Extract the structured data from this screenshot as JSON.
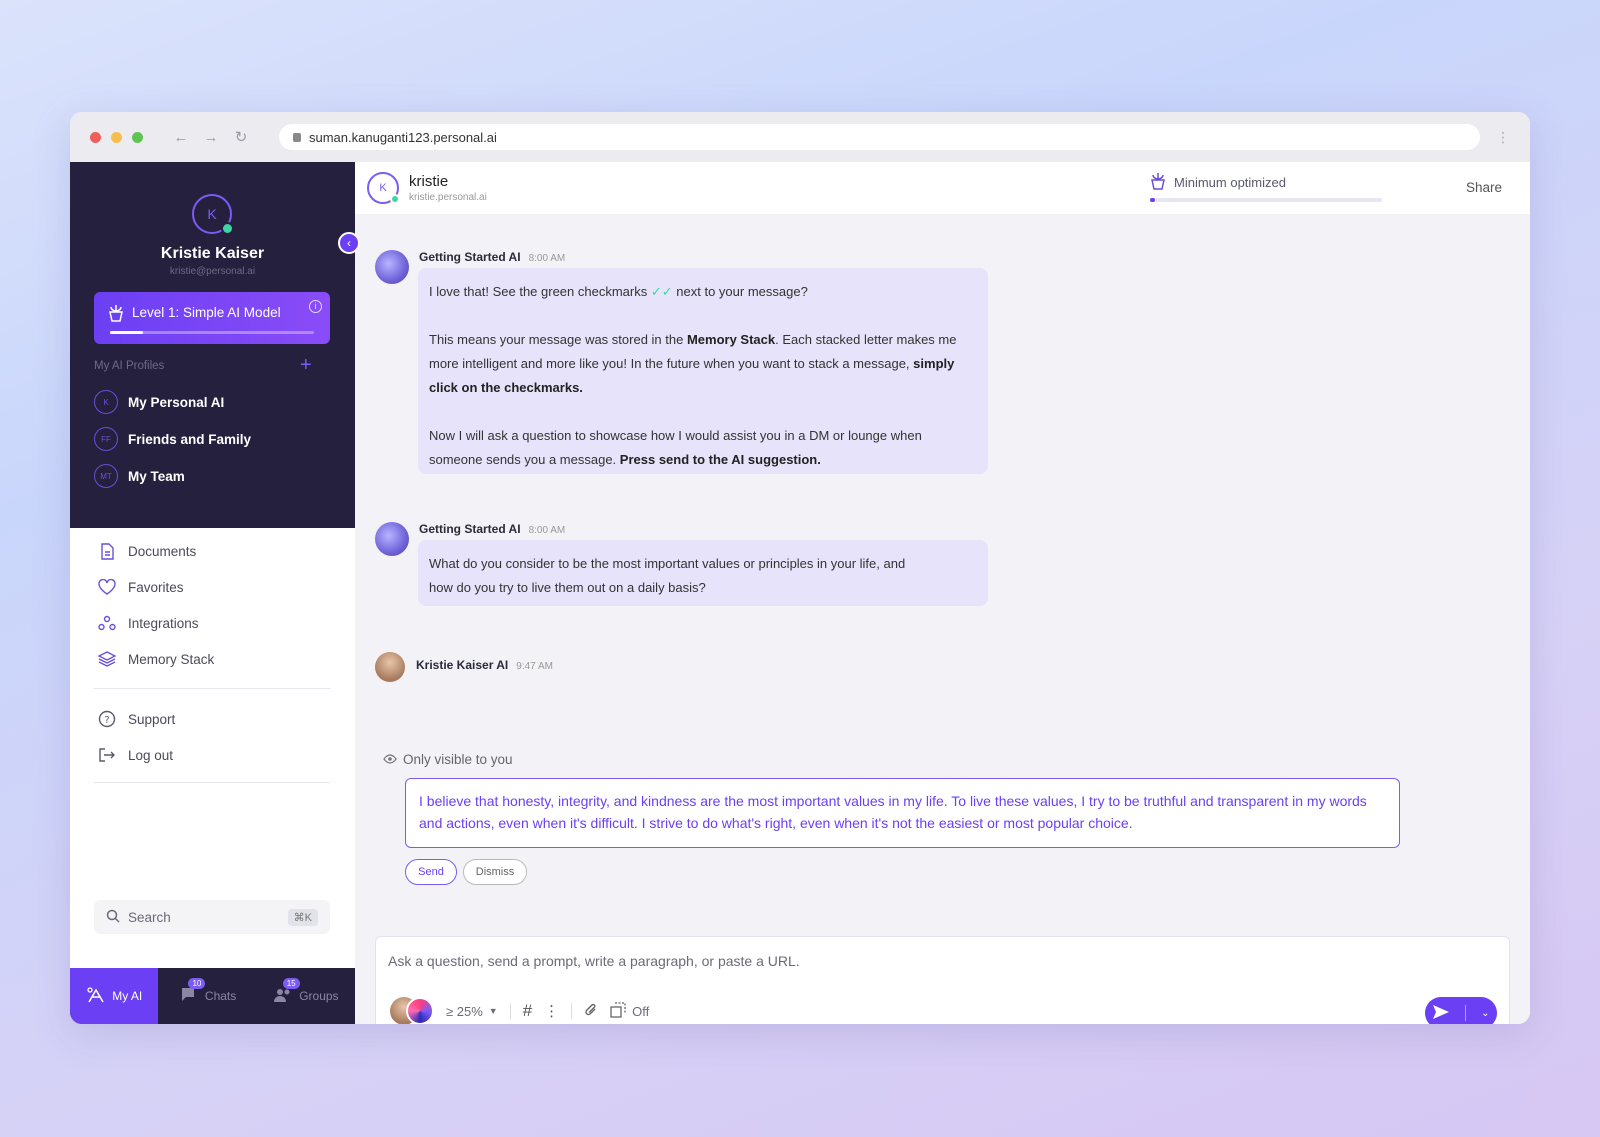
{
  "browser": {
    "url": "suman.kanuganti123.personal.ai",
    "colors": {
      "close": "#ed5f5a",
      "minimize": "#f5be4f",
      "maximize": "#5fc454"
    }
  },
  "sidebar": {
    "avatar_initial": "K",
    "user_name": "Kristie Kaiser",
    "user_email": "kristie@personal.ai",
    "level": {
      "label": "Level 1: Simple AI Model",
      "progress": 0.16
    },
    "profiles_heading": "My AI Profiles",
    "profiles": [
      {
        "initials": "K",
        "label": "My Personal AI"
      },
      {
        "initials": "FF",
        "label": "Friends and Family"
      },
      {
        "initials": "MT",
        "label": "My Team"
      }
    ],
    "nav": [
      {
        "label": "Documents",
        "icon": "document-icon"
      },
      {
        "label": "Favorites",
        "icon": "heart-icon"
      },
      {
        "label": "Integrations",
        "icon": "integrations-icon"
      },
      {
        "label": "Memory Stack",
        "icon": "layers-icon"
      }
    ],
    "support": [
      {
        "label": "Support",
        "icon": "help-icon"
      },
      {
        "label": "Log out",
        "icon": "logout-icon"
      }
    ],
    "search": {
      "placeholder": "Search",
      "shortcut": "⌘K"
    },
    "tabs": [
      {
        "label": "My AI",
        "badge": ""
      },
      {
        "label": "Chats",
        "badge": "10"
      },
      {
        "label": "Groups",
        "badge": "15"
      }
    ]
  },
  "header": {
    "avatar_initial": "K",
    "name": "kristie",
    "handle": "kristie.personal.ai",
    "optimization": {
      "label": "Minimum optimized",
      "progress": 0.02
    },
    "share_label": "Share"
  },
  "messages": [
    {
      "sender": "Getting Started AI",
      "time": "8:00 AM",
      "p1a": "I love that! See the green checkmarks",
      "p1b": "next to your message?",
      "p2a": "This means your message was stored in the",
      "p2b": "Memory Stack",
      "p2c": ". Each stacked letter makes me more intelligent and more like you! In the future when you want to stack a message,",
      "p2d": "simply click on the checkmarks.",
      "p3a": "Now I will ask a question to showcase how I would assist you in a DM or lounge when someone sends you a message.",
      "p3b": "Press send to the AI suggestion."
    },
    {
      "sender": "Getting Started AI",
      "time": "8:00 AM",
      "text": "What do you consider to be the most important values or principles in your life, and how do you try to live them out on a daily basis?"
    },
    {
      "sender": "Kristie Kaiser AI",
      "time": "9:47 AM",
      "visibility": "Only visible to you",
      "suggestion": "I believe that honesty, integrity, and kindness are the most important values in my life. To live these values, I try to be truthful and transparent in my words and actions, even when it's difficult. I strive to do what's right, even when it's not the easiest or most popular choice.",
      "send_label": "Send",
      "dismiss_label": "Dismiss"
    }
  ],
  "composer": {
    "placeholder": "Ask a question, send a prompt, write a paragraph, or paste a URL.",
    "threshold": "≥ 25%",
    "toggle_label": "Off"
  },
  "colors": {
    "accent": "#6b3ff3",
    "sidebar_bg": "#25203d",
    "check": "#3ed6a5"
  }
}
